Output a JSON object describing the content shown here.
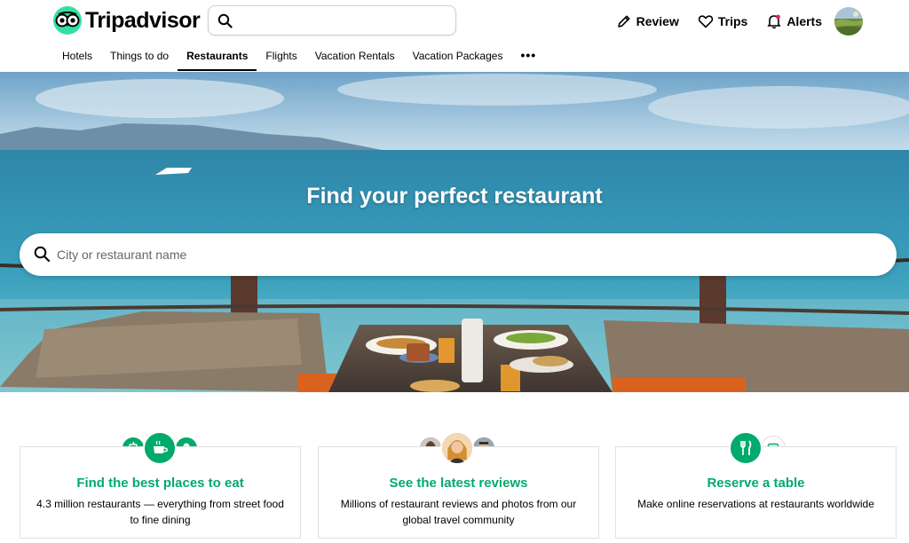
{
  "brand": {
    "name": "Tripadvisor",
    "accent": "#34e0a1",
    "green": "#00aa6c"
  },
  "header": {
    "search_placeholder": "",
    "actions": [
      {
        "label": "Review",
        "icon": "pencil-icon"
      },
      {
        "label": "Trips",
        "icon": "heart-icon"
      },
      {
        "label": "Alerts",
        "icon": "bell-icon"
      }
    ]
  },
  "tabs": [
    {
      "label": "Hotels",
      "active": false
    },
    {
      "label": "Things to do",
      "active": false
    },
    {
      "label": "Restaurants",
      "active": true
    },
    {
      "label": "Flights",
      "active": false
    },
    {
      "label": "Vacation Rentals",
      "active": false
    },
    {
      "label": "Vacation Packages",
      "active": false
    }
  ],
  "more_icon": "more-dots-icon",
  "hero": {
    "title": "Find your perfect restaurant",
    "search_placeholder": "City or restaurant name"
  },
  "cards": [
    {
      "title": "Find the best places to eat",
      "desc": "4.3 million restaurants — everything from street food to fine dining",
      "icons": [
        "drink-icon",
        "coffee-icon",
        "ice-cream-icon"
      ]
    },
    {
      "title": "See the latest reviews",
      "desc": "Millions of restaurant reviews and photos from our global travel community",
      "icons": [
        "reviewer-avatar",
        "reviewer-avatar",
        "reviewer-avatar"
      ]
    },
    {
      "title": "Reserve a table",
      "desc": "Make online reservations at restaurants worldwide",
      "icons": [
        "cutlery-icon",
        "calendar-icon"
      ]
    }
  ]
}
